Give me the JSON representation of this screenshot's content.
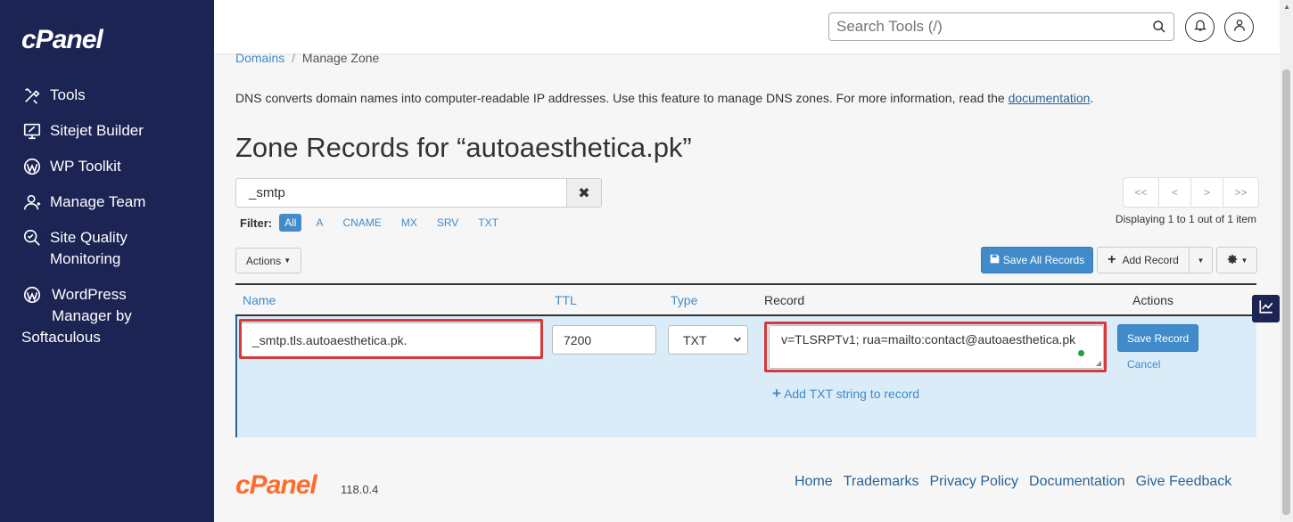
{
  "sidebar": {
    "logo": "cPanel",
    "items": [
      {
        "label": "Tools",
        "icon": "tools-icon"
      },
      {
        "label": "Sitejet Builder",
        "icon": "sitejet-icon"
      },
      {
        "label": "WP Toolkit",
        "icon": "wordpress-icon"
      },
      {
        "label": "Manage Team",
        "icon": "team-icon"
      },
      {
        "label": "Site Quality",
        "label2": "Monitoring",
        "icon": "quality-icon"
      },
      {
        "label": "WordPress",
        "label2": "Manager by",
        "label3": "Softaculous",
        "icon": "wordpress-icon"
      }
    ]
  },
  "header": {
    "search_placeholder": "Search Tools (/)"
  },
  "breadcrumb": {
    "root": "Domains",
    "separator": "/",
    "current": "Manage Zone"
  },
  "description": {
    "text": "DNS converts domain names into computer-readable IP addresses. Use this feature to manage DNS zones. For more information, read the ",
    "link": "documentation",
    "end": "."
  },
  "page_title": "Zone Records for “autoaesthetica.pk”",
  "filter": {
    "search_value": "_smtp",
    "clear": "✖",
    "label": "Filter:",
    "options": [
      "All",
      "A",
      "CNAME",
      "MX",
      "SRV",
      "TXT"
    ],
    "active": "All"
  },
  "pager": {
    "first": "<<",
    "prev": "<",
    "next": ">",
    "last": ">>",
    "displaying": "Displaying 1 to 1 out of 1 item"
  },
  "toolbar": {
    "actions": "Actions",
    "save_all": "Save All Records",
    "add_record": "Add Record"
  },
  "table": {
    "headers": {
      "name": "Name",
      "ttl": "TTL",
      "type": "Type",
      "record": "Record",
      "actions": "Actions"
    },
    "edit": {
      "name": "_smtp.tls.autoaesthetica.pk.",
      "ttl": "7200",
      "type": "TXT",
      "record": "v=TLSRPTv1; rua=mailto:contact@autoaesthetica.pk",
      "add_txt": "Add TXT string to record",
      "save": "Save Record",
      "cancel": "Cancel"
    }
  },
  "footer": {
    "logo": "cPanel",
    "version": "118.0.4",
    "links": [
      "Home",
      "Trademarks",
      "Privacy Policy",
      "Documentation",
      "Give Feedback"
    ]
  },
  "colors": {
    "sidebar_bg": "#1b2452",
    "link": "#428bca",
    "primary_button": "#428bca",
    "highlight": "#d9383a",
    "edit_row_bg": "#d9ecf8",
    "footer_logo": "#ff6c2c"
  }
}
